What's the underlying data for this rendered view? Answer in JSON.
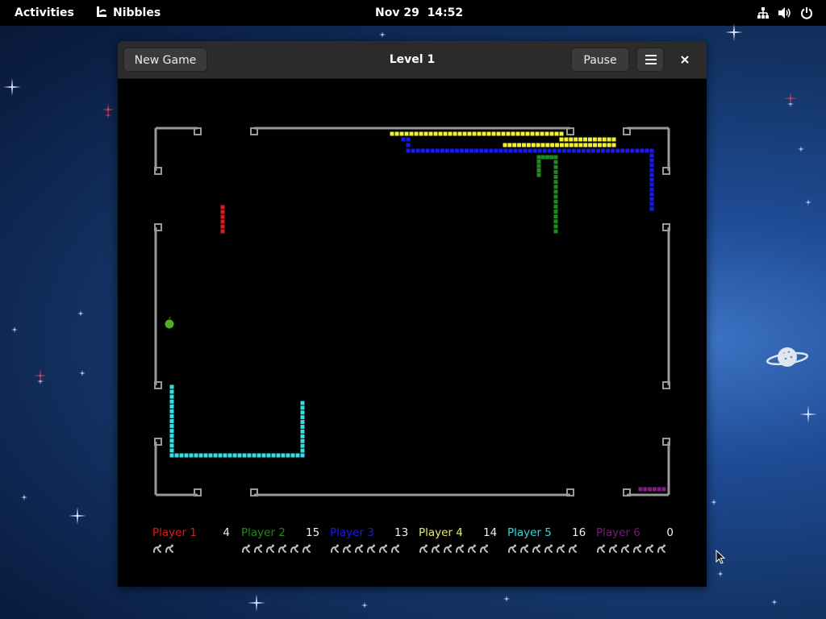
{
  "topbar": {
    "activities": "Activities",
    "app_name": "Nibbles",
    "clock": "Nov 29  14:52",
    "tray_icons": [
      "network-icon",
      "volume-icon",
      "power-icon"
    ]
  },
  "window": {
    "title": "Level 1",
    "new_game_label": "New Game",
    "pause_label": "Pause",
    "menu_icon": "hamburger-menu-icon",
    "close_icon": "close-icon"
  },
  "colors": {
    "wall": "#9a9a9a",
    "player1": "#e01b1b",
    "player2": "#1f8a1f",
    "player3": "#1a1aee",
    "player4": "#f2f230",
    "player5": "#33e0e6",
    "player6": "#8a1a8a",
    "apple": "#4caf20"
  },
  "players": [
    {
      "name": "Player 1",
      "score": "4",
      "color": "#e01b1b",
      "lives": 2
    },
    {
      "name": "Player 2",
      "score": "15",
      "color": "#1f8a1f",
      "lives": 6
    },
    {
      "name": "Player 3",
      "score": "13",
      "color": "#1a1aee",
      "lives": 6
    },
    {
      "name": "Player 4",
      "score": "14",
      "color": "#e8e870",
      "lives": 6
    },
    {
      "name": "Player 5",
      "score": "16",
      "color": "#33d8de",
      "lives": 6
    },
    {
      "name": "Player 6",
      "score": "0",
      "color": "#7a1a7a",
      "lives": 6
    }
  ]
}
